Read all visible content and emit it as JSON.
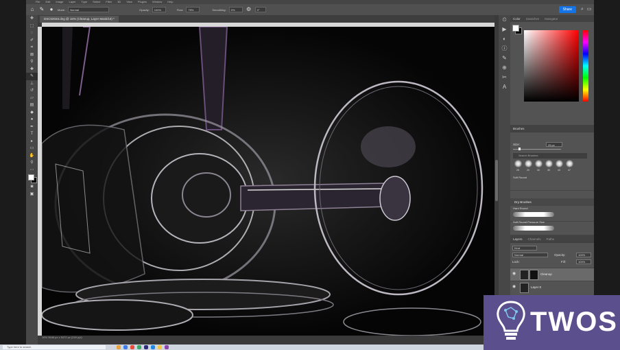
{
  "menubar": {
    "items": [
      "File",
      "Edit",
      "Image",
      "Layer",
      "Type",
      "Select",
      "Filter",
      "3D",
      "View",
      "Plugins",
      "Window",
      "Help"
    ]
  },
  "options": {
    "mode_label": "Mode:",
    "mode_value": "Normal",
    "opacity_label": "Opacity:",
    "opacity_value": "100%",
    "flow_label": "Flow:",
    "flow_value": "75%",
    "smoothing_label": "Smoothing:",
    "smoothing_value": "0%",
    "angle_value": "0°",
    "share_label": "Share"
  },
  "document": {
    "tab_label": "DSC02033.dng @ 16% (Cleanup, Layer Mask/16) *",
    "status": "16%   3648 px x 5472 px (240 ppi)"
  },
  "color_panel": {
    "tab_color": "Color",
    "tab_swatches": "Swatches",
    "tab_navigator": "Navigator",
    "fg": "#ffffff",
    "bg": "#000000"
  },
  "brushes_panel": {
    "tab": "Brushes",
    "size_label": "Size:",
    "size_value": "25 px",
    "search_placeholder": "Search Brushes",
    "tips": [
      "25",
      "20",
      "30",
      "35",
      "40",
      "47"
    ],
    "folder": "Dry Brushes",
    "items": [
      "Soft Round",
      "Hard Round",
      "Soft Round Pressure Size"
    ]
  },
  "layers_panel": {
    "tab_layers": "Layers",
    "tab_channels": "Channels",
    "tab_paths": "Paths",
    "kind_label": "Kind",
    "blend_mode": "Normal",
    "opacity_label": "Opacity:",
    "opacity_value": "100%",
    "lock_label": "Lock:",
    "fill_label": "Fill:",
    "fill_value": "100%",
    "layers": [
      "Cleanup",
      "Layer 0"
    ]
  },
  "taskbar": {
    "search_placeholder": "Type here to search"
  },
  "watermark": {
    "text": "TWOS"
  }
}
